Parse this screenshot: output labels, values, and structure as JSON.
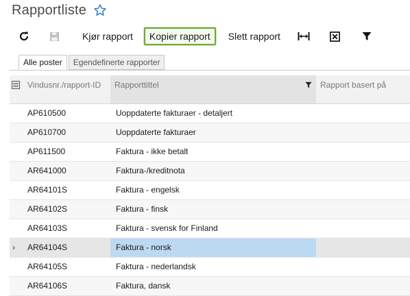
{
  "page": {
    "title": "Rapportliste"
  },
  "toolbar": {
    "refresh_icon": "refresh-icon",
    "save_icon": "save-icon",
    "run_label": "Kjør rapport",
    "copy_label": "Kopier rapport",
    "delete_label": "Slett rapport",
    "fit_icon": "fit-columns-icon",
    "excel_icon": "export-excel-icon",
    "filter_icon": "filter-icon"
  },
  "tabs": [
    {
      "label": "Alle poster",
      "active": true
    },
    {
      "label": "Egendefinerte rapporter",
      "active": false
    }
  ],
  "grid": {
    "columns": {
      "id": "Vindusnr./rapport-ID",
      "title": "Rapporttittel",
      "base": "Rapport basert på"
    },
    "rows": [
      {
        "id": "AP610500",
        "title": "Uoppdaterte fakturaer - detaljert",
        "base": ""
      },
      {
        "id": "AP610700",
        "title": "Uoppdaterte fakturaer",
        "base": ""
      },
      {
        "id": "AP611500",
        "title": "Faktura - ikke betalt",
        "base": ""
      },
      {
        "id": "AR641000",
        "title": "Faktura-/kreditnota",
        "base": ""
      },
      {
        "id": "AR64101S",
        "title": "Faktura - engelsk",
        "base": ""
      },
      {
        "id": "AR64102S",
        "title": "Faktura - finsk",
        "base": ""
      },
      {
        "id": "AR64103S",
        "title": "Faktura - svensk for Finland",
        "base": ""
      },
      {
        "id": "AR64104S",
        "title": "Faktura - norsk",
        "base": "",
        "current": true
      },
      {
        "id": "AR64105S",
        "title": "Faktura - nederlandsk",
        "base": ""
      },
      {
        "id": "AR64106S",
        "title": "Faktura, dansk",
        "base": ""
      }
    ],
    "current_row_indicator": "›"
  },
  "colors": {
    "focus_border": "#6aaa3a",
    "selected_cell": "#bcd9f2",
    "star": "#2f7fd1"
  }
}
